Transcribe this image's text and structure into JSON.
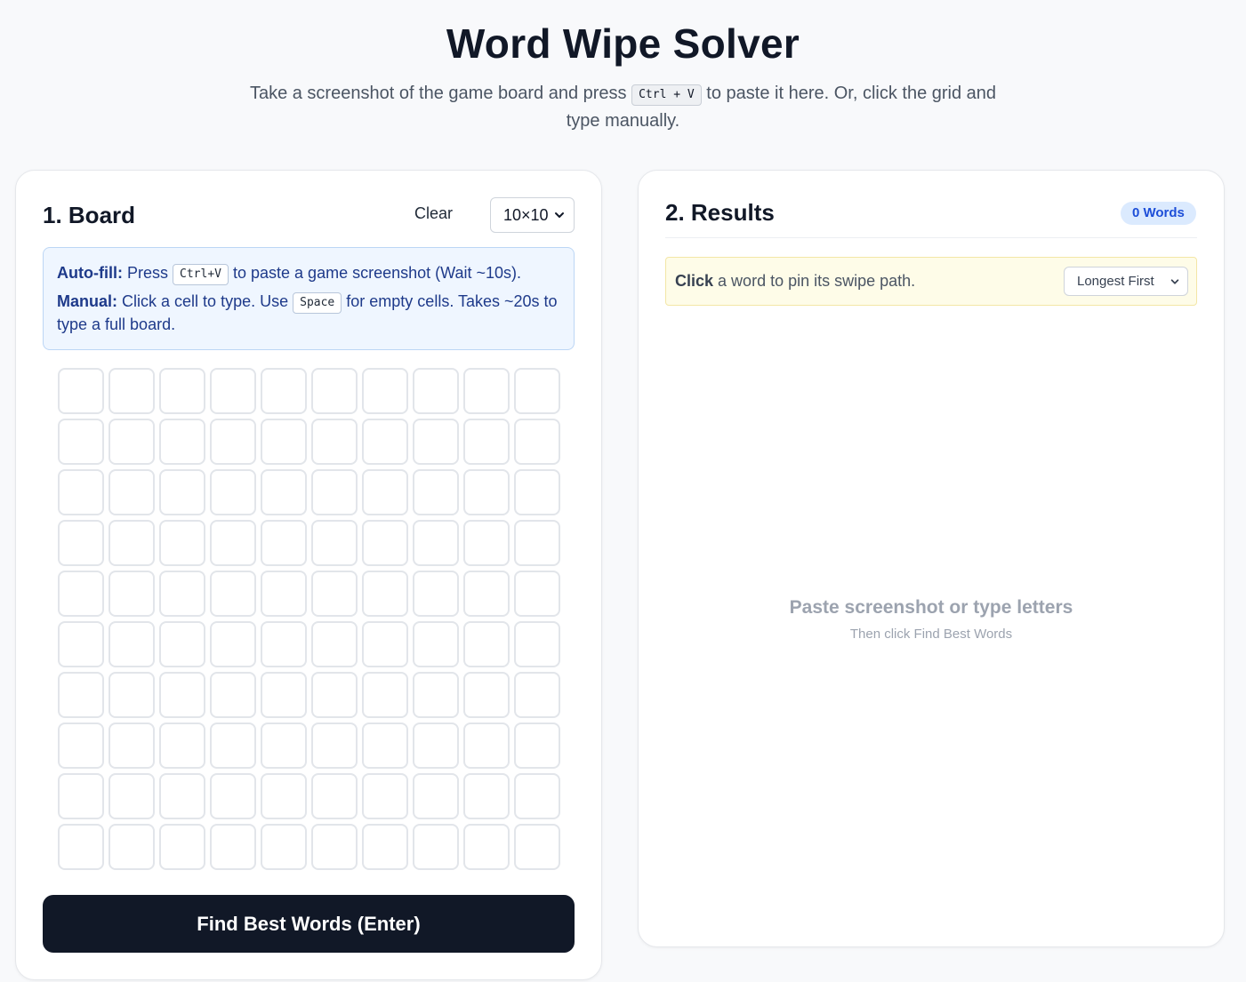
{
  "header": {
    "title": "Word Wipe Solver",
    "subtitle_before": "Take a screenshot of the game board and press",
    "subtitle_kbd": "Ctrl + V",
    "subtitle_after": "to paste it here. Or, click the grid and type manually."
  },
  "board": {
    "title": "1. Board",
    "clear_label": "Clear",
    "size_selected": "10×10",
    "info": {
      "autofill_label": "Auto-fill:",
      "autofill_before": "Press",
      "autofill_kbd": "Ctrl+V",
      "autofill_after": "to paste a game screenshot (Wait ~10s).",
      "manual_label": "Manual:",
      "manual_before": "Click a cell to type. Use",
      "manual_kbd": "Space",
      "manual_after": "for empty cells. Takes ~20s to type a full board."
    },
    "grid": {
      "rows": 10,
      "cols": 10
    },
    "find_button_label": "Find Best Words (Enter)"
  },
  "results": {
    "title": "2. Results",
    "badge": "0 Words",
    "hint_bold": "Click",
    "hint_rest": "a word to pin its swipe path.",
    "sort_selected": "Longest First",
    "empty_title": "Paste screenshot or type letters",
    "empty_subtitle": "Then click Find Best Words"
  },
  "colors": {
    "primary_button": "#111827",
    "info_bg": "#eff6ff",
    "info_text": "#1e3a8a",
    "hint_bg": "#fefce8",
    "badge_bg": "#dbeafe",
    "badge_text": "#1d4ed8"
  },
  "icons": {
    "size_select": "chevron-down-icon",
    "sort_select": "chevron-down-icon"
  }
}
